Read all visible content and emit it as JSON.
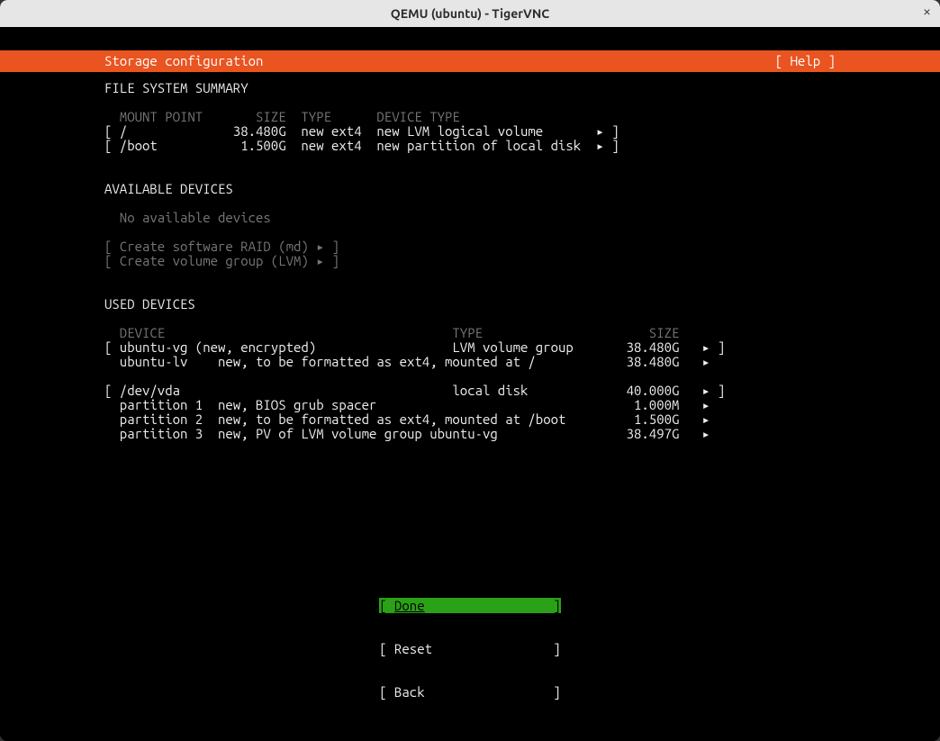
{
  "window": {
    "title": "QEMU (ubuntu) - TigerVNC",
    "close_glyph": "×"
  },
  "header": {
    "title": "Storage configuration",
    "help": "[ Help ]"
  },
  "sections": {
    "fs_summary_title": "FILE SYSTEM SUMMARY",
    "fs_header": {
      "mount": "MOUNT POINT",
      "size": "SIZE",
      "type": "TYPE",
      "devtype": "DEVICE TYPE"
    },
    "fs_rows": [
      {
        "mount": "/",
        "size": "38.480G",
        "type": "new ext4",
        "devtype": "new LVM logical volume"
      },
      {
        "mount": "/boot",
        "size": "1.500G",
        "type": "new ext4",
        "devtype": "new partition of local disk"
      }
    ],
    "avail_title": "AVAILABLE DEVICES",
    "avail_none": "No available devices",
    "create_raid": "Create software RAID (md) ▸",
    "create_lvm": "Create volume group (LVM) ▸",
    "used_title": "USED DEVICES",
    "used_header": {
      "device": "DEVICE",
      "type": "TYPE",
      "size": "SIZE"
    },
    "used_vg": {
      "device": "ubuntu-vg (new, encrypted)",
      "type": "LVM volume group",
      "size": "38.480G",
      "child_name": "ubuntu-lv",
      "child_desc": "new, to be formatted as ext4, mounted at /",
      "child_size": "38.480G"
    },
    "used_disk": {
      "device": "/dev/vda",
      "type": "local disk",
      "size": "40.000G",
      "parts": [
        {
          "name": "partition 1",
          "desc": "new, BIOS grub spacer",
          "size": "1.000M"
        },
        {
          "name": "partition 2",
          "desc": "new, to be formatted as ext4, mounted at /boot",
          "size": "1.500G"
        },
        {
          "name": "partition 3",
          "desc": "new, PV of LVM volume group ubuntu-vg",
          "size": "38.497G"
        }
      ]
    }
  },
  "buttons": {
    "done": "[ Done                 ]",
    "done_label": "Done",
    "reset": "[ Reset                ]",
    "back": "[ Back                 ]"
  },
  "glyphs": {
    "tri": "▸"
  }
}
